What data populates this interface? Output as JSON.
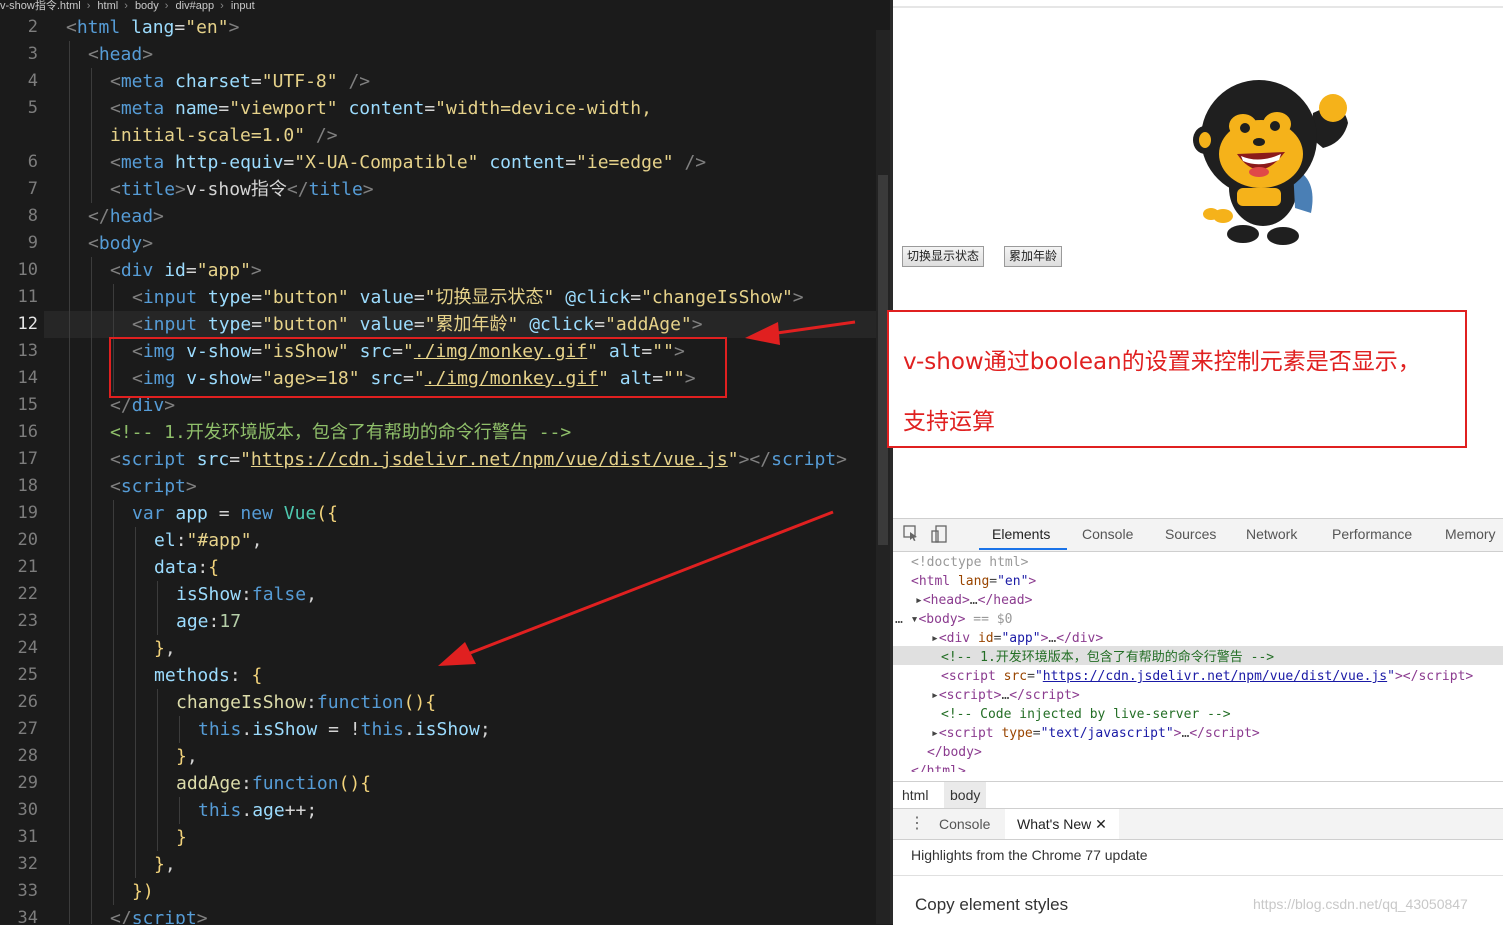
{
  "breadcrumb": [
    "v-show指令.html",
    "html",
    "body",
    "div#app",
    "input"
  ],
  "editor": {
    "line_numbers": [
      "2",
      "3",
      "4",
      "5",
      "",
      "6",
      "7",
      "8",
      "9",
      "10",
      "11",
      "12",
      "13",
      "14",
      "15",
      "16",
      "17",
      "18",
      "19",
      "20",
      "21",
      "22",
      "23",
      "24",
      "25",
      "26",
      "27",
      "28",
      "29",
      "30",
      "31",
      "32",
      "33",
      "34"
    ],
    "current_line": "12"
  },
  "page": {
    "buttons": [
      "切换显示状态",
      "累加年龄"
    ],
    "image_alt": ""
  },
  "annotation": {
    "line1": "v-show通过boolean的设置来控制元素是否显示，",
    "line2": "支持运算"
  },
  "devtools": {
    "tabs": [
      "Elements",
      "Console",
      "Sources",
      "Network",
      "Performance",
      "Memory"
    ],
    "active_tab": "Elements",
    "selected_suffix": "== $0",
    "crumbs": [
      "html",
      "body"
    ],
    "drawer_tabs": [
      "Console",
      "What's New"
    ],
    "drawer_heading": "Highlights from the Chrome 77 update",
    "drawer_item": "Copy element styles"
  },
  "watermark": "https://blog.csdn.net/qq_43050847",
  "colors": {
    "annotation_red": "#e02020",
    "devtools_accent": "#1a73e8"
  }
}
